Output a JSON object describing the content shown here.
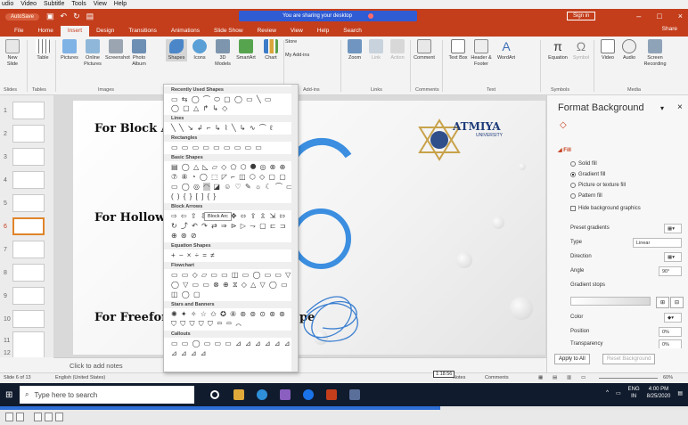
{
  "player_menu": [
    "udio",
    "Video",
    "Subtitle",
    "Tools",
    "View",
    "Help"
  ],
  "titlebar": {
    "autosave": "AutoSave",
    "sharing_text": "You are sharing your desktop",
    "signin": "Sign in",
    "controls": [
      "–",
      "□",
      "×"
    ]
  },
  "tabs": [
    "File",
    "Home",
    "Insert",
    "Design",
    "Transitions",
    "Animations",
    "Slide Show",
    "Review",
    "View",
    "Help",
    "Search"
  ],
  "active_tab": "Insert",
  "share": "Share",
  "ribbon": {
    "buttons": [
      "New Slide",
      "Table",
      "Pictures",
      "Online Pictures",
      "Screenshot",
      "Photo Album",
      "Shapes",
      "Icons",
      "3D Models",
      "SmartArt",
      "Chart",
      "Store",
      "My Add-ins",
      "Zoom",
      "Link",
      "Action",
      "Comment",
      "Text Box",
      "Header & Footer",
      "WordArt",
      "Equation",
      "Symbol",
      "Video",
      "Audio",
      "Screen Recording"
    ],
    "groups": [
      "Slides",
      "Tables",
      "Images",
      "Add-ins",
      "Links",
      "Comments",
      "Text",
      "Symbols",
      "Media"
    ]
  },
  "slide_numbers": [
    "1",
    "2",
    "3",
    "4",
    "5",
    "6",
    "7",
    "8",
    "9",
    "10",
    "11",
    "12"
  ],
  "active_slide": "6",
  "slide": {
    "texts": [
      "For Block A",
      "For Hollow",
      "For Freefor",
      "pe"
    ],
    "logo": "ATMIYA",
    "logo_sub": "UNIVERSITY"
  },
  "shapes_menu": {
    "categories": [
      "Recently Used Shapes",
      "Lines",
      "Rectangles",
      "Basic Shapes",
      "Block Arrows",
      "Equation Shapes",
      "Flowchart",
      "Stars and Banners",
      "Callouts"
    ],
    "tooltip": "Block Arc"
  },
  "notes_placeholder": "Click to add notes",
  "format_pane": {
    "title": "Format Background",
    "section": "Fill",
    "fill_options": [
      "Solid fill",
      "Gradient fill",
      "Picture or texture fill",
      "Pattern fill"
    ],
    "selected_fill": "Gradient fill",
    "hide_graphics": "Hide background graphics",
    "props": [
      {
        "label": "Preset gradients",
        "value": ""
      },
      {
        "label": "Type",
        "value": "Linear"
      },
      {
        "label": "Direction",
        "value": ""
      },
      {
        "label": "Angle",
        "value": "90°"
      },
      {
        "label": "Gradient stops",
        "value": ""
      },
      {
        "label": "Color",
        "value": ""
      },
      {
        "label": "Position",
        "value": "0%"
      },
      {
        "label": "Transparency",
        "value": "0%"
      }
    ],
    "apply_all": "Apply to All",
    "reset": "Reset Background"
  },
  "status": {
    "slide_info": "Slide 6 of 13",
    "language": "English (United States)",
    "notes": "Notes",
    "comments": "Comments",
    "zoom": "60%",
    "time_badge": "1:18:56"
  },
  "taskbar": {
    "search_placeholder": "Type here to search",
    "lang": "ENG",
    "region": "IN",
    "time": "4:00 PM",
    "date": "8/25/2020"
  },
  "video_progress": 0.64,
  "colors": {
    "accent": "#c43e1c",
    "arc_blue": "#3b8ee0",
    "taskbar": "#101b2d"
  }
}
